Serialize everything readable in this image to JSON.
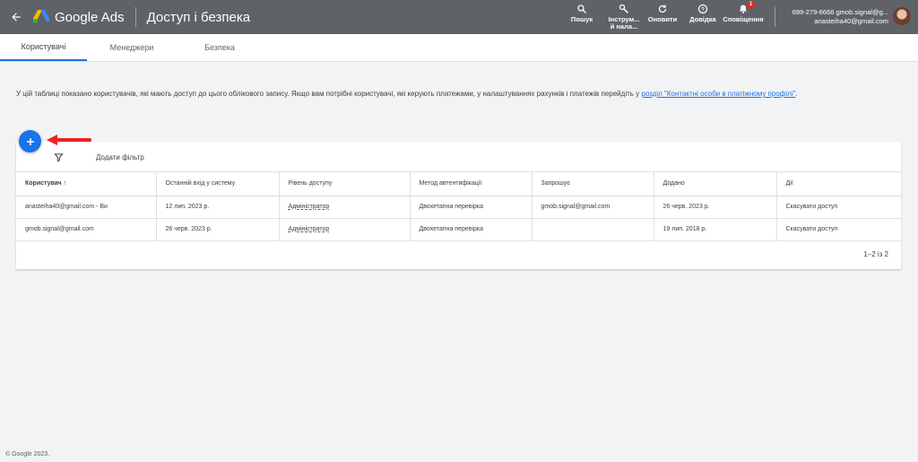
{
  "header": {
    "brand": "Google Ads",
    "page_title": "Доступ і безпека",
    "tools": {
      "search": "Пошук",
      "tools_line1": "Інструм...",
      "tools_line2": "й нала...",
      "refresh": "Оновити",
      "help": "Довідка",
      "notifications": "Сповіщення",
      "notifications_badge": "1"
    },
    "account": {
      "line1": "699-279-6666 gmob.signal@g...",
      "line2": "anasteiha40@gmail.com"
    }
  },
  "tabs": [
    {
      "label": "Користувачі",
      "active": true
    },
    {
      "label": "Менеджери",
      "active": false
    },
    {
      "label": "Безпека",
      "active": false
    }
  ],
  "info": {
    "text": "У цій таблиці показано користувачів, які мають доступ до цього облікового запису. Якщо вам потрібні користувачі, які керують платежами, у налаштуваннях рахунків і платежів перейдіть у ",
    "link": "розділ \"Контактні особи в платіжному профілі\"",
    "suffix": "."
  },
  "filter": {
    "label": "Додати фільтр"
  },
  "table": {
    "headers": [
      "Користувач",
      "Останній вхід у систему",
      "Рівень доступу",
      "Метод автентифікації",
      "Запрошує",
      "Додано",
      "Дії"
    ],
    "sort_icon": "arrow-up-icon",
    "rows": [
      [
        "anasteiha40@gmail.com - Ви",
        "12 лип. 2023 р.",
        "Адміністратор",
        "Двохетапна перевірка",
        "gmob.signal@gmail.com",
        "26 черв. 2023 р.",
        "Скасувати доступ"
      ],
      [
        "gmob.signal@gmail.com",
        "26 черв. 2023 р.",
        "Адміністратор",
        "Двохетапна перевірка",
        "",
        "19 лип. 2018 р.",
        "Скасувати доступ"
      ]
    ],
    "pager": "1–2 із 2"
  },
  "footer": "© Google 2023.",
  "colors": {
    "topbar": "#5f6368",
    "accent": "#1a73e8",
    "arrow": "#e8231f"
  }
}
